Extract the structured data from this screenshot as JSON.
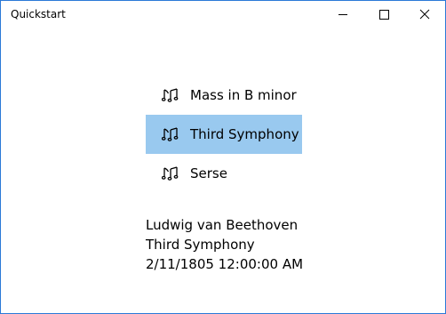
{
  "window": {
    "title": "Quickstart"
  },
  "titlebar_buttons": {
    "minimize_icon": "minimize-icon",
    "maximize_icon": "maximize-icon",
    "close_icon": "close-icon"
  },
  "songs": [
    {
      "label": "Mass in B minor",
      "icon": "music-note-icon",
      "selected": false
    },
    {
      "label": "Third Symphony",
      "icon": "music-note-icon",
      "selected": true
    },
    {
      "label": "Serse",
      "icon": "music-note-icon",
      "selected": false
    }
  ],
  "details": {
    "composer": "Ludwig van Beethoven",
    "title": "Third Symphony",
    "release_date": "2/11/1805 12:00:00 AM"
  },
  "colors": {
    "selection": "#99c9ef",
    "window_border": "#2b79d7"
  }
}
